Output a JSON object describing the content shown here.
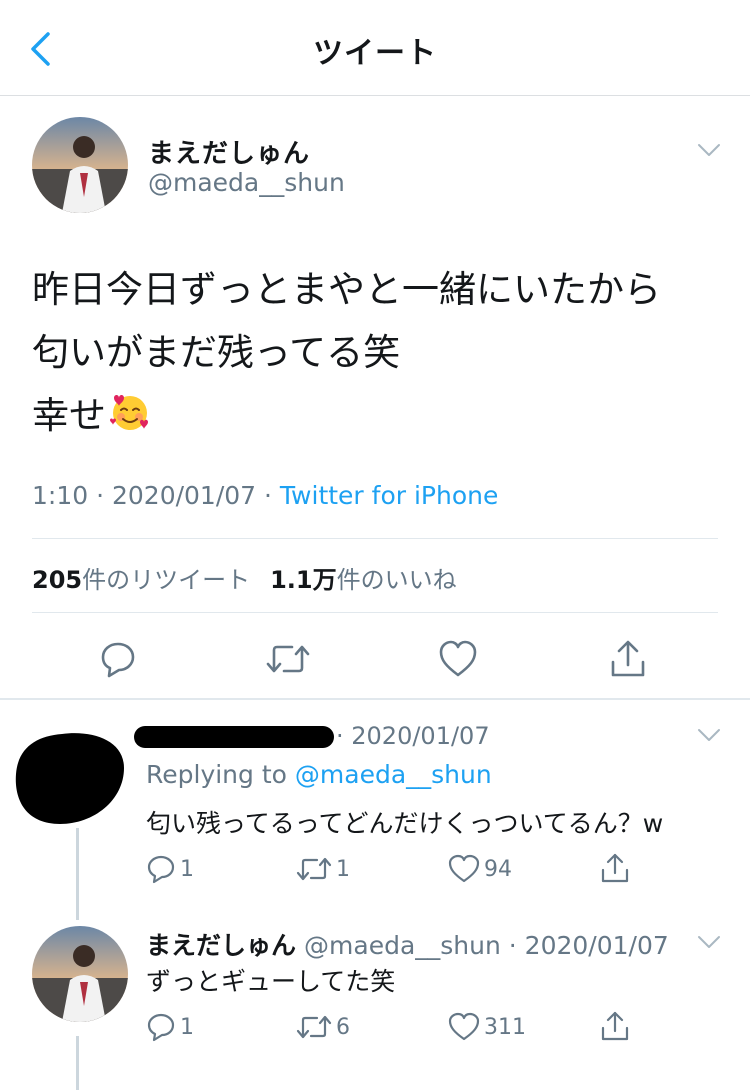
{
  "header": {
    "title": "ツイート"
  },
  "main_tweet": {
    "name": "まえだしゅん",
    "handle": "@maeda__shun",
    "lines": [
      "昨日今日ずっとまやと一緒にいたから",
      "匂いがまだ残ってる笑",
      "幸せ"
    ],
    "emoji": "smiling-face-with-hearts",
    "time": "1:10",
    "date": "2020/01/07",
    "source": "Twitter for iPhone",
    "retweet_count": "205",
    "retweet_label": "件のリツイート",
    "like_count": "1.1万",
    "like_label": "件のいいね"
  },
  "reply1": {
    "date": "2020/01/07",
    "replying_prefix": "Replying to",
    "replying_to": "@maeda__shun",
    "text": "匂い残ってるってどんだけくっついてるん？w",
    "reply_count": "1",
    "retweet_count": "1",
    "like_count": "94"
  },
  "reply2": {
    "name": "まえだしゅん",
    "handle": "@maeda__shun",
    "date": "2020/01/07",
    "text": "ずっとギューしてた笑",
    "reply_count": "1",
    "retweet_count": "6",
    "like_count": "311"
  },
  "colors": {
    "accent": "#1da1f2",
    "secondary_text": "#657786",
    "primary_text": "#14171a",
    "divider": "#e1e8ed"
  }
}
